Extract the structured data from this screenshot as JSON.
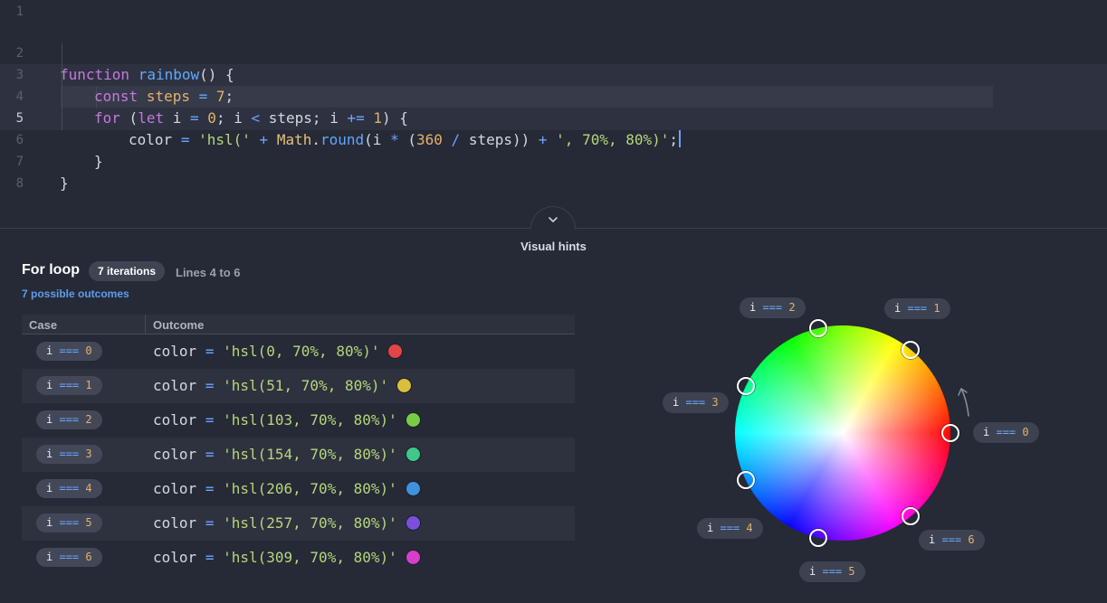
{
  "editor": {
    "line_numbers": [
      "1",
      "2",
      "3",
      "4",
      "5",
      "6",
      "7",
      "8"
    ],
    "active_line": 5
  },
  "panel": {
    "title": "Visual hints",
    "loop_type": "For loop",
    "iterations_badge": "7 iterations",
    "lines_label": "Lines 4 to 6",
    "outcomes_label": "7 possible outcomes",
    "col_case": "Case",
    "col_outcome": "Outcome"
  },
  "cases": [
    {
      "i": "0",
      "hsl": "'hsl(0, 70%, 80%)'",
      "swatch": "#e04646"
    },
    {
      "i": "1",
      "hsl": "'hsl(51, 70%, 80%)'",
      "swatch": "#d9bf3c"
    },
    {
      "i": "2",
      "hsl": "'hsl(103, 70%, 80%)'",
      "swatch": "#78cd46"
    },
    {
      "i": "3",
      "hsl": "'hsl(154, 70%, 80%)'",
      "swatch": "#3fc88a"
    },
    {
      "i": "4",
      "hsl": "'hsl(206, 70%, 80%)'",
      "swatch": "#3f93dc"
    },
    {
      "i": "5",
      "hsl": "'hsl(257, 70%, 80%)'",
      "swatch": "#7a4fdc"
    },
    {
      "i": "6",
      "hsl": "'hsl(309, 70%, 80%)'",
      "swatch": "#d63fc9"
    }
  ],
  "colors": {
    "background": "#262a36",
    "accent": "#5d9cf0"
  }
}
